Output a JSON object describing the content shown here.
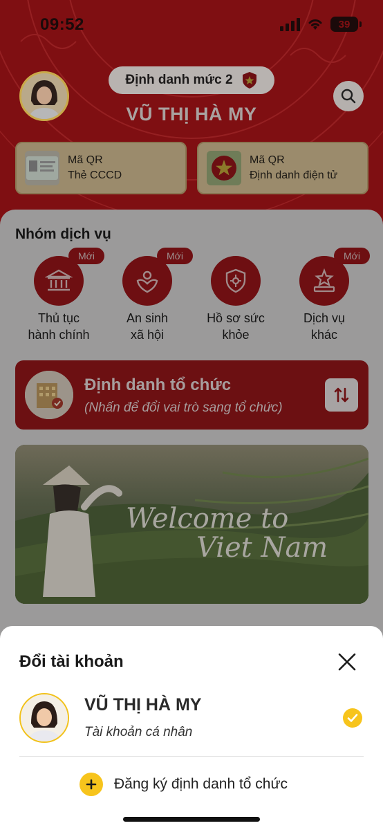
{
  "status_bar": {
    "time": "09:52",
    "battery": "39"
  },
  "profile": {
    "level_label": "Định danh mức 2",
    "name": "VŨ THỊ HÀ MY"
  },
  "qr_cards": [
    {
      "line1": "Mã QR",
      "line2": "Thẻ CCCD"
    },
    {
      "line1": "Mã QR",
      "line2": "Định danh điện tử"
    }
  ],
  "services": {
    "title": "Nhóm dịch vụ",
    "new_badge": "Mới",
    "items": [
      {
        "line1": "Thủ tục",
        "line2": "hành chính",
        "is_new": true,
        "icon": "bank-icon"
      },
      {
        "line1": "An sinh",
        "line2": "xã hội",
        "is_new": true,
        "icon": "social-care-icon"
      },
      {
        "line1": "Hồ sơ sức",
        "line2": "khỏe",
        "is_new": false,
        "icon": "health-shield-icon"
      },
      {
        "line1": "Dịch vụ",
        "line2": "khác",
        "is_new": true,
        "icon": "star-podium-icon"
      }
    ]
  },
  "org_card": {
    "title": "Định danh tổ chức",
    "subtitle": "(Nhấn để đổi vai trò sang tổ chức)"
  },
  "banner": {
    "line1": "Welcome to",
    "line2": "Viet Nam"
  },
  "sheet": {
    "title": "Đổi tài khoản",
    "account_name": "VŨ THỊ HÀ MY",
    "account_type": "Tài khoản cá nhân",
    "add_label": "Đăng ký định danh tổ chức"
  },
  "colors": {
    "brand_red": "#c8191d",
    "accent_yellow": "#f7c41c",
    "overlay": "rgba(0,0,0,0.4)"
  }
}
